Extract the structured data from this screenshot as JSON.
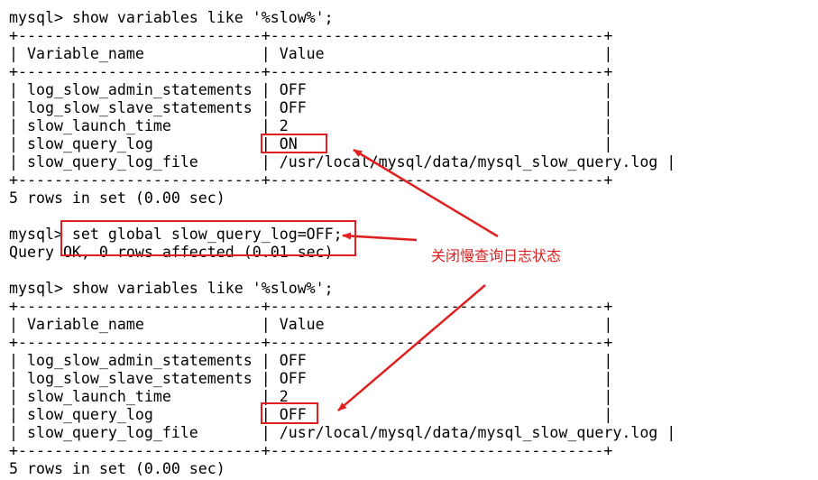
{
  "terminal": {
    "lines": [
      "mysql> show variables like '%slow%';",
      "+---------------------------+-------------------------------------+",
      "| Variable_name             | Value                               |",
      "+---------------------------+-------------------------------------+",
      "| log_slow_admin_statements | OFF                                 |",
      "| log_slow_slave_statements | OFF                                 |",
      "| slow_launch_time          | 2                                   |",
      "| slow_query_log            | ON                                  |",
      "| slow_query_log_file       | /usr/local/mysql/data/mysql_slow_query.log |",
      "+---------------------------+-------------------------------------+",
      "5 rows in set (0.00 sec)",
      "",
      "mysql> set global slow_query_log=OFF;",
      "Query OK, 0 rows affected (0.01 sec)",
      "",
      "mysql> show variables like '%slow%';",
      "+---------------------------+-------------------------------------+",
      "| Variable_name             | Value                               |",
      "+---------------------------+-------------------------------------+",
      "| log_slow_admin_statements | OFF                                 |",
      "| log_slow_slave_statements | OFF                                 |",
      "| slow_launch_time          | 2                                   |",
      "| slow_query_log            | OFF                                 |",
      "| slow_query_log_file       | /usr/local/mysql/data/mysql_slow_query.log |",
      "+---------------------------+-------------------------------------+",
      "5 rows in set (0.00 sec)"
    ]
  },
  "annotation": {
    "text": "关闭慢查询日志状态",
    "color": "#e02020"
  },
  "colors": {
    "background": "#ffffff",
    "text": "#000000",
    "highlight": "#e02020"
  }
}
